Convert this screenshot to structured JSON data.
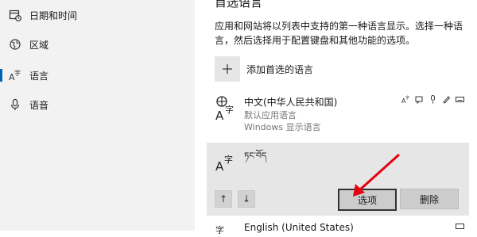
{
  "sidebar": {
    "items": [
      {
        "label": "日期和时间",
        "icon": "calendar-clock-icon"
      },
      {
        "label": "区域",
        "icon": "globe-region-icon"
      },
      {
        "label": "语言",
        "icon": "language-icon"
      },
      {
        "label": "语音",
        "icon": "microphone-icon"
      }
    ]
  },
  "main": {
    "heading": "首选语言",
    "description": "应用和网站将以列表中支持的第一种语言显示。选择一种语言，然后选择用于配置键盘和其他功能的选项。",
    "add_language_label": "添加首选的语言",
    "languages": [
      {
        "name": "中文(中华人民共和国)",
        "sub1": "默认应用语言",
        "sub2": "Windows 显示语言"
      },
      {
        "name": "ཏང་བོད"
      },
      {
        "name": "English (United States)"
      }
    ],
    "options_label": "选项",
    "delete_label": "删除",
    "up_label": "↑",
    "down_label": "↓"
  },
  "colors": {
    "sidebar_bg": "#f2f2f2",
    "selected_bg": "#e6e6e6",
    "accent": "#0063b1",
    "annotation_arrow": "#e60012"
  }
}
